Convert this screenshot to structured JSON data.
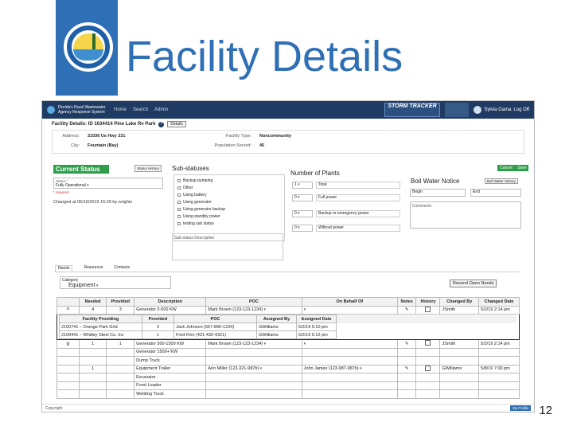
{
  "slide": {
    "title": "Facility Details",
    "page_number": "12"
  },
  "app": {
    "brand": "Florida's Rural Wastewater Agency Response System",
    "nav": [
      "Home",
      "Search",
      "Admin"
    ],
    "storm_tracker": "STORM TRACKER",
    "user": "Sylvia Gama",
    "logoff": "Log Off"
  },
  "facility": {
    "header": "Facility Details: ID 1034414 Pine Lake Rv Park",
    "details_btn": "Details",
    "address_label": "Address:",
    "address": "21036 Us Hwy 231",
    "city_label": "City:",
    "city": "Fountain (Bay)",
    "type_label": "Facility Type:",
    "type": "Noncommunity",
    "pop_label": "Population Served:",
    "pop": "45"
  },
  "status": {
    "title": "Current Status",
    "history_btn": "Status History",
    "cancel": "Cancel",
    "save": "Save",
    "field_label": "Status *",
    "value": "Fully Operational",
    "required": "* required",
    "changed": "Changed at 05/10/2019 15:29 by wrights"
  },
  "substatus": {
    "title": "Sub-statuses",
    "items": [
      "Backup pumping",
      "Other",
      "Using battery",
      "Using generator",
      "Using generator backup",
      "Using standby power",
      "testing sub status"
    ],
    "desc_placeholder": "Sub-status Description"
  },
  "plants": {
    "title": "Number of Plants",
    "rows": [
      {
        "num": "1",
        "label": "Total"
      },
      {
        "num": "0",
        "label": "Full power"
      },
      {
        "num": "0",
        "label": "Backup or emergency power"
      },
      {
        "num": "0",
        "label": "Without power"
      }
    ]
  },
  "boil": {
    "title": "Boil Water Notice",
    "history_btn": "Boil Water History",
    "begin": "Begin",
    "end": "End",
    "comments": "Comments"
  },
  "tabs": [
    "Needs",
    "Resources",
    "Contacts"
  ],
  "category": {
    "label": "Category",
    "value": "Equipment"
  },
  "resend": "Resend Open Needs",
  "needs": {
    "headers": [
      "",
      "Needed",
      "Provided",
      "Description",
      "POC",
      "On Behalf Of",
      "Notes",
      "History",
      "Changed By",
      "Changed Date"
    ],
    "row1": {
      "arrow": "^",
      "needed": "4",
      "provided": "3",
      "desc": "Generator 0-500 KW",
      "poc": "Mark Brown (123-123-1234)",
      "behalf": "",
      "by": "JSmith",
      "date": "5/2/19 2:14 pm"
    },
    "prov_headers": [
      "Facility Providing",
      "Provided",
      "POC",
      "Assigned By",
      "Assigned Date"
    ],
    "prov_rows": [
      {
        "fac": "2100741 – Orange Park Grid",
        "prov": "2",
        "poc": "Jack Johnson (567-890-1234)",
        "by": "GWilliams",
        "date": "5/2/19 5:10 pm"
      },
      {
        "fac": "2109441 – Whitley Steel Co. Inc",
        "prov": "1",
        "poc": "Fred Finn (421-432-4321)",
        "by": "GWilliams",
        "date": "5/2/19 5:12 pm"
      }
    ],
    "row2": {
      "arrow": "v",
      "needed": "1",
      "provided": "1",
      "desc": "Generator 500-1500 KW",
      "poc": "Mark Brown (123-123-1234)",
      "by": "JSmith",
      "date": "5/2/19 2:14 pm"
    },
    "row3": {
      "desc": "Generator 1500+ KW"
    },
    "row4": {
      "desc": "Dump Truck"
    },
    "row5": {
      "needed": "1",
      "desc": "Equipment Trailer",
      "poc": "Ann Miller (123-321-987b)",
      "behalf": "John James (123-987-987b)",
      "by": "GWilliams",
      "date": "5/8/19 7:00 pm"
    },
    "row6": {
      "desc": "Excavator"
    },
    "row7": {
      "desc": "Front Loader"
    },
    "row8": {
      "desc": "Welding Truck"
    }
  },
  "footer": {
    "copyright": "Copyright",
    "profile": "My Profile"
  }
}
